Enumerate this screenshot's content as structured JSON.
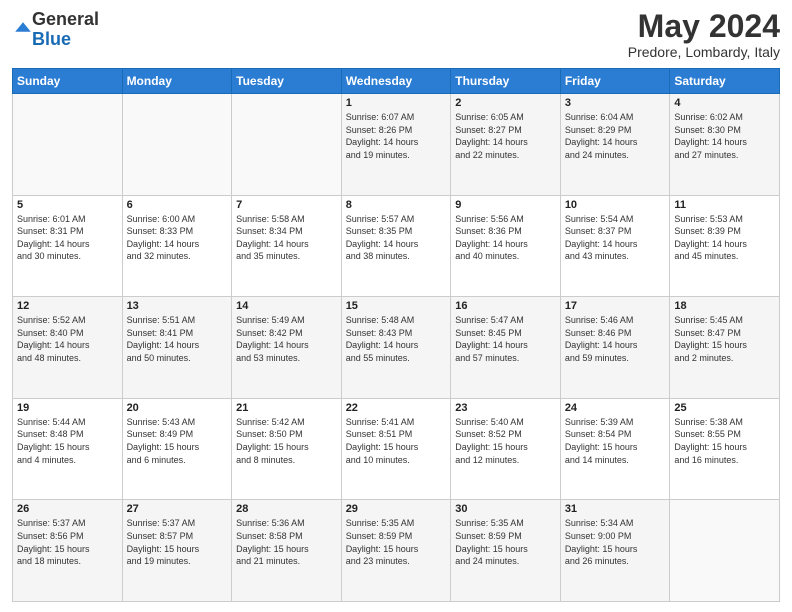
{
  "logo": {
    "general": "General",
    "blue": "Blue"
  },
  "title": "May 2024",
  "location": "Predore, Lombardy, Italy",
  "days_header": [
    "Sunday",
    "Monday",
    "Tuesday",
    "Wednesday",
    "Thursday",
    "Friday",
    "Saturday"
  ],
  "weeks": [
    [
      {
        "day": "",
        "info": ""
      },
      {
        "day": "",
        "info": ""
      },
      {
        "day": "",
        "info": ""
      },
      {
        "day": "1",
        "info": "Sunrise: 6:07 AM\nSunset: 8:26 PM\nDaylight: 14 hours\nand 19 minutes."
      },
      {
        "day": "2",
        "info": "Sunrise: 6:05 AM\nSunset: 8:27 PM\nDaylight: 14 hours\nand 22 minutes."
      },
      {
        "day": "3",
        "info": "Sunrise: 6:04 AM\nSunset: 8:29 PM\nDaylight: 14 hours\nand 24 minutes."
      },
      {
        "day": "4",
        "info": "Sunrise: 6:02 AM\nSunset: 8:30 PM\nDaylight: 14 hours\nand 27 minutes."
      }
    ],
    [
      {
        "day": "5",
        "info": "Sunrise: 6:01 AM\nSunset: 8:31 PM\nDaylight: 14 hours\nand 30 minutes."
      },
      {
        "day": "6",
        "info": "Sunrise: 6:00 AM\nSunset: 8:33 PM\nDaylight: 14 hours\nand 32 minutes."
      },
      {
        "day": "7",
        "info": "Sunrise: 5:58 AM\nSunset: 8:34 PM\nDaylight: 14 hours\nand 35 minutes."
      },
      {
        "day": "8",
        "info": "Sunrise: 5:57 AM\nSunset: 8:35 PM\nDaylight: 14 hours\nand 38 minutes."
      },
      {
        "day": "9",
        "info": "Sunrise: 5:56 AM\nSunset: 8:36 PM\nDaylight: 14 hours\nand 40 minutes."
      },
      {
        "day": "10",
        "info": "Sunrise: 5:54 AM\nSunset: 8:37 PM\nDaylight: 14 hours\nand 43 minutes."
      },
      {
        "day": "11",
        "info": "Sunrise: 5:53 AM\nSunset: 8:39 PM\nDaylight: 14 hours\nand 45 minutes."
      }
    ],
    [
      {
        "day": "12",
        "info": "Sunrise: 5:52 AM\nSunset: 8:40 PM\nDaylight: 14 hours\nand 48 minutes."
      },
      {
        "day": "13",
        "info": "Sunrise: 5:51 AM\nSunset: 8:41 PM\nDaylight: 14 hours\nand 50 minutes."
      },
      {
        "day": "14",
        "info": "Sunrise: 5:49 AM\nSunset: 8:42 PM\nDaylight: 14 hours\nand 53 minutes."
      },
      {
        "day": "15",
        "info": "Sunrise: 5:48 AM\nSunset: 8:43 PM\nDaylight: 14 hours\nand 55 minutes."
      },
      {
        "day": "16",
        "info": "Sunrise: 5:47 AM\nSunset: 8:45 PM\nDaylight: 14 hours\nand 57 minutes."
      },
      {
        "day": "17",
        "info": "Sunrise: 5:46 AM\nSunset: 8:46 PM\nDaylight: 14 hours\nand 59 minutes."
      },
      {
        "day": "18",
        "info": "Sunrise: 5:45 AM\nSunset: 8:47 PM\nDaylight: 15 hours\nand 2 minutes."
      }
    ],
    [
      {
        "day": "19",
        "info": "Sunrise: 5:44 AM\nSunset: 8:48 PM\nDaylight: 15 hours\nand 4 minutes."
      },
      {
        "day": "20",
        "info": "Sunrise: 5:43 AM\nSunset: 8:49 PM\nDaylight: 15 hours\nand 6 minutes."
      },
      {
        "day": "21",
        "info": "Sunrise: 5:42 AM\nSunset: 8:50 PM\nDaylight: 15 hours\nand 8 minutes."
      },
      {
        "day": "22",
        "info": "Sunrise: 5:41 AM\nSunset: 8:51 PM\nDaylight: 15 hours\nand 10 minutes."
      },
      {
        "day": "23",
        "info": "Sunrise: 5:40 AM\nSunset: 8:52 PM\nDaylight: 15 hours\nand 12 minutes."
      },
      {
        "day": "24",
        "info": "Sunrise: 5:39 AM\nSunset: 8:54 PM\nDaylight: 15 hours\nand 14 minutes."
      },
      {
        "day": "25",
        "info": "Sunrise: 5:38 AM\nSunset: 8:55 PM\nDaylight: 15 hours\nand 16 minutes."
      }
    ],
    [
      {
        "day": "26",
        "info": "Sunrise: 5:37 AM\nSunset: 8:56 PM\nDaylight: 15 hours\nand 18 minutes."
      },
      {
        "day": "27",
        "info": "Sunrise: 5:37 AM\nSunset: 8:57 PM\nDaylight: 15 hours\nand 19 minutes."
      },
      {
        "day": "28",
        "info": "Sunrise: 5:36 AM\nSunset: 8:58 PM\nDaylight: 15 hours\nand 21 minutes."
      },
      {
        "day": "29",
        "info": "Sunrise: 5:35 AM\nSunset: 8:59 PM\nDaylight: 15 hours\nand 23 minutes."
      },
      {
        "day": "30",
        "info": "Sunrise: 5:35 AM\nSunset: 8:59 PM\nDaylight: 15 hours\nand 24 minutes."
      },
      {
        "day": "31",
        "info": "Sunrise: 5:34 AM\nSunset: 9:00 PM\nDaylight: 15 hours\nand 26 minutes."
      },
      {
        "day": "",
        "info": ""
      }
    ]
  ]
}
